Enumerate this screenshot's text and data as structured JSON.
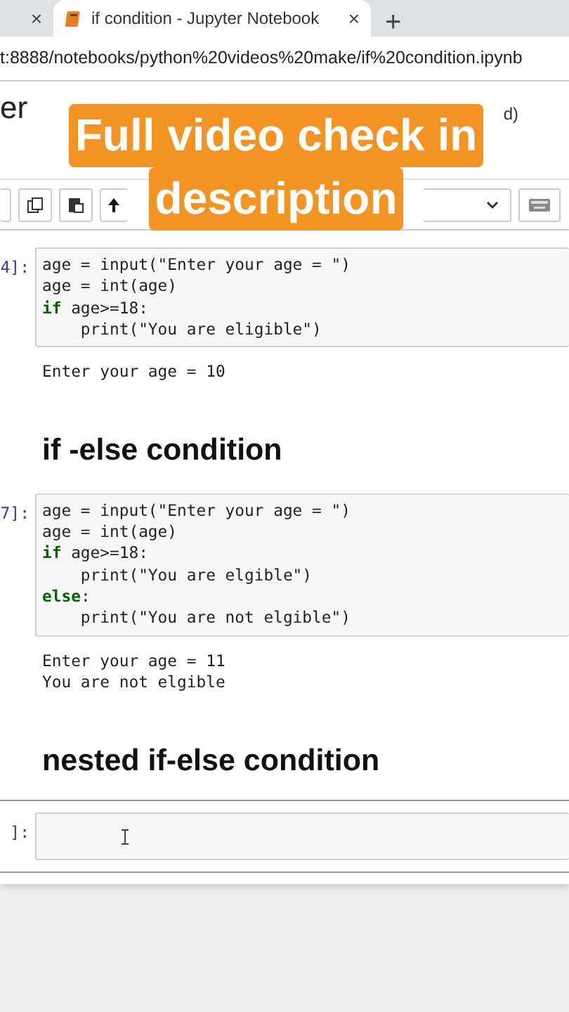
{
  "browser": {
    "tabs": [
      {
        "close": "×",
        "selected": false
      },
      {
        "title": "if condition - Jupyter Notebook",
        "close": "×",
        "selected": true
      }
    ],
    "new_tab": "+",
    "address": "t:8888/notebooks/python%20videos%20make/if%20condition.ipynb"
  },
  "header": {
    "logo_text": "er",
    "status_text": "d)"
  },
  "caption": [
    "Full video check in",
    "description"
  ],
  "cells": [
    {
      "kind": "code",
      "prompt": "4]:",
      "active": false,
      "code": [
        "age = input(\"Enter your age = \")",
        "age = int(age)",
        "**if** age>=18:",
        "    print(\"You are eligible\")"
      ],
      "output": [
        "Enter your age = 10"
      ]
    },
    {
      "kind": "heading",
      "text": "if -else condition"
    },
    {
      "kind": "code",
      "prompt": "7]:",
      "active": false,
      "code": [
        "age = input(\"Enter your age = \")",
        "age = int(age)",
        "**if** age>=18:",
        "    print(\"You are elgible\")",
        "**else**:",
        "    print(\"You are not elgible\")"
      ],
      "output": [
        "Enter your age = 11",
        "You are not elgible"
      ]
    },
    {
      "kind": "heading",
      "text": "nested if-else condition"
    },
    {
      "kind": "code",
      "prompt": "]:",
      "active": true
    }
  ]
}
